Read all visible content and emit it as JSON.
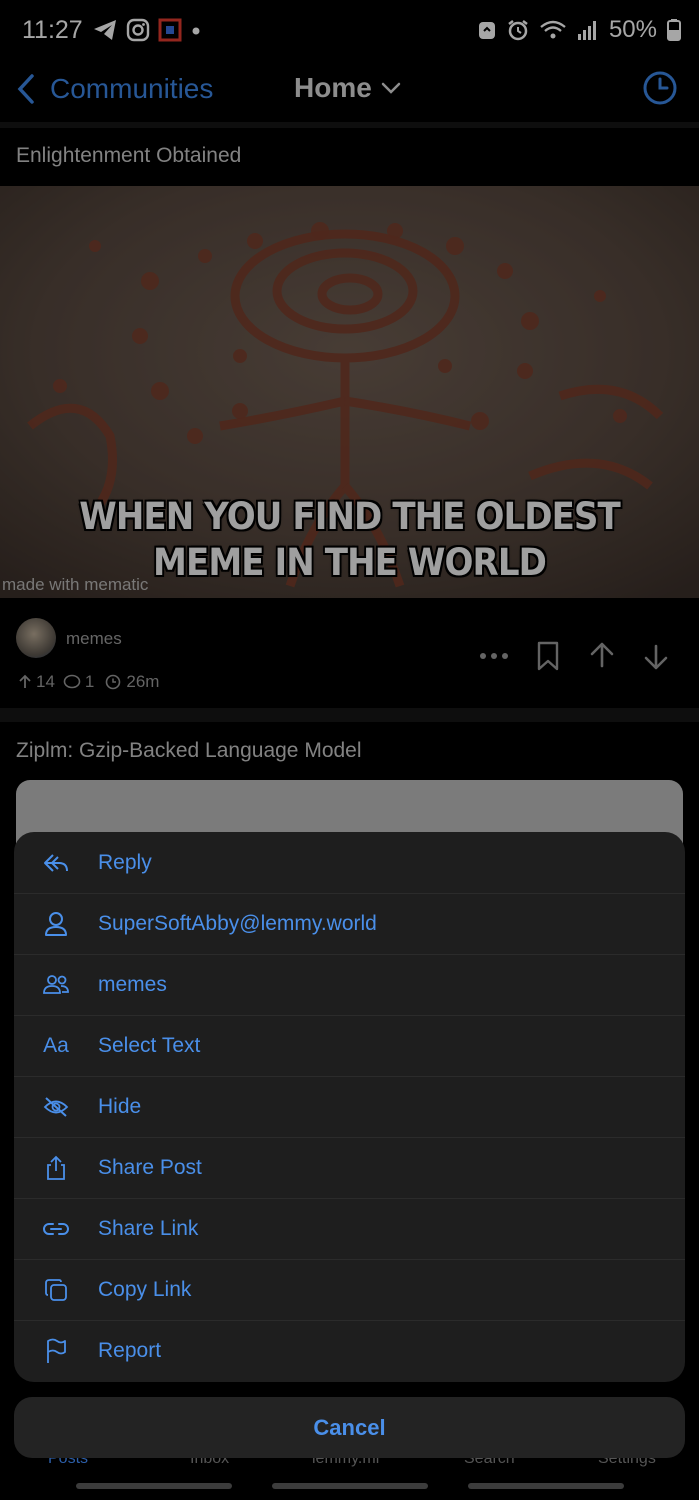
{
  "status_bar": {
    "time": "11:27",
    "battery": "50%"
  },
  "nav": {
    "back_label": "Communities",
    "feed_label": "Home"
  },
  "posts": [
    {
      "title": "Enlightenment Obtained",
      "image_caption": "WHEN YOU FIND THE OLDEST MEME IN THE WORLD",
      "image_watermark": "made with mematic",
      "community": "memes",
      "score": "14",
      "comments": "1",
      "age": "26m"
    },
    {
      "title": "Ziplm: Gzip-Backed Language Model"
    }
  ],
  "action_sheet": {
    "items": [
      {
        "label": "Reply",
        "icon": "reply-icon"
      },
      {
        "label": "SuperSoftAbby@lemmy.world",
        "icon": "user-icon"
      },
      {
        "label": "memes",
        "icon": "community-icon"
      },
      {
        "label": "Select Text",
        "icon": "text-icon"
      },
      {
        "label": "Hide",
        "icon": "eye-off-icon"
      },
      {
        "label": "Share Post",
        "icon": "share-icon"
      },
      {
        "label": "Share Link",
        "icon": "link-icon"
      },
      {
        "label": "Copy Link",
        "icon": "copy-icon"
      },
      {
        "label": "Report",
        "icon": "flag-icon"
      }
    ],
    "cancel_label": "Cancel"
  },
  "tab_bar": {
    "tabs": [
      "Posts",
      "Inbox",
      "lemmy.ml",
      "Search",
      "Settings"
    ]
  },
  "colors": {
    "accent": "#4a8fe9",
    "background": "#000000",
    "sheet": "#1e1e1e"
  }
}
